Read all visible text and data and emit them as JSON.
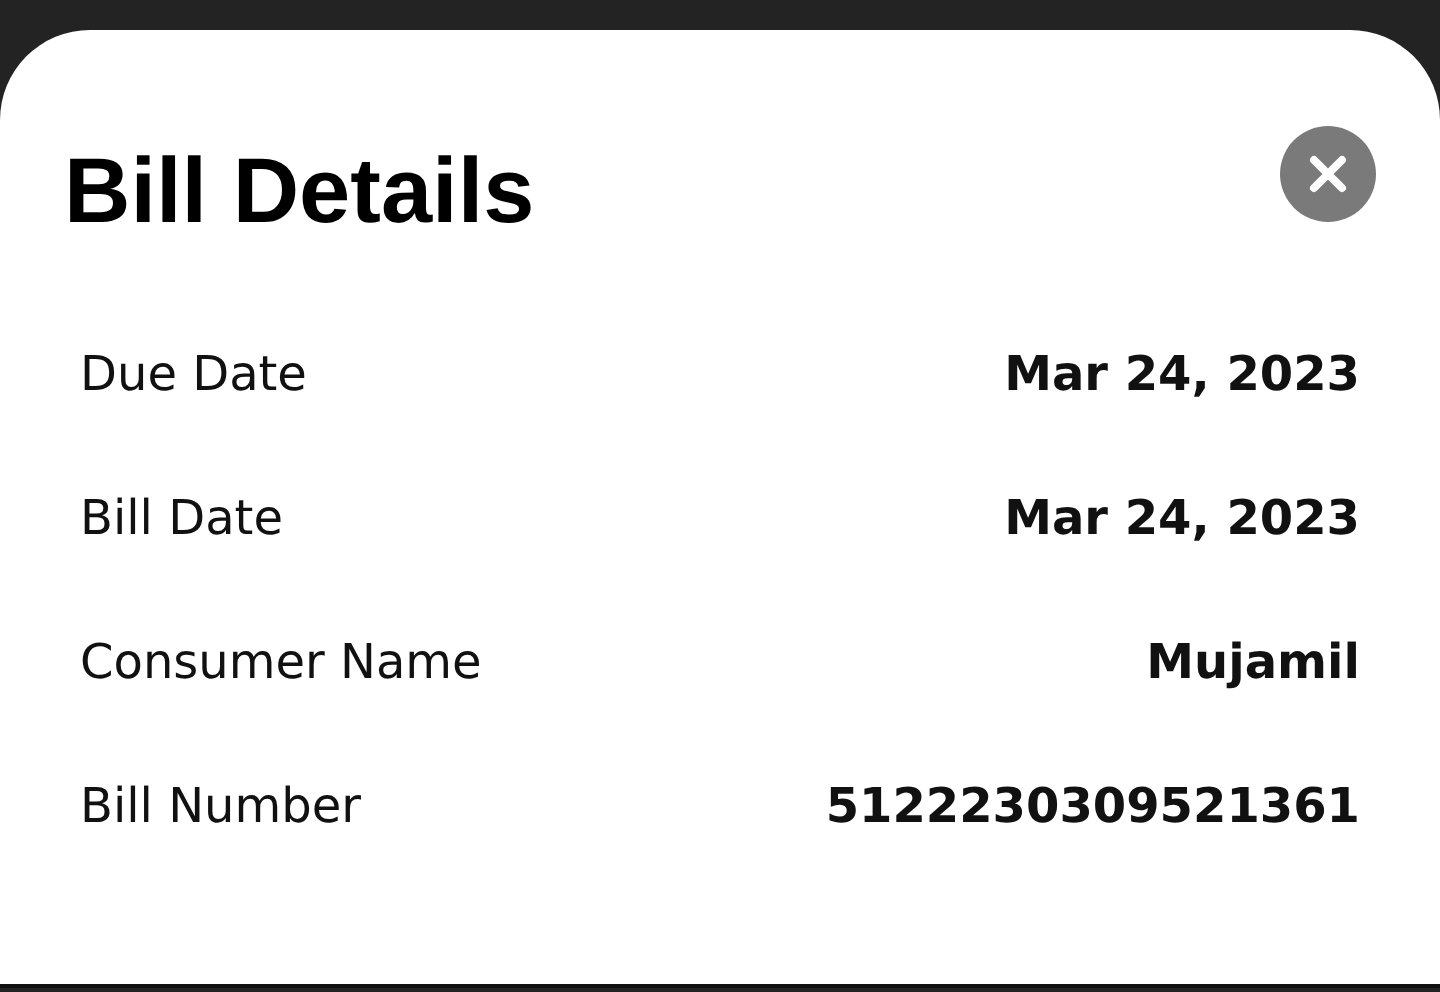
{
  "sheet": {
    "title": "Bill Details",
    "rows": [
      {
        "label": "Due Date",
        "value": "Mar 24, 2023"
      },
      {
        "label": "Bill Date",
        "value": "Mar 24, 2023"
      },
      {
        "label": "Consumer Name",
        "value": "Mujamil"
      },
      {
        "label": "Bill Number",
        "value": "5122230309521361"
      }
    ]
  }
}
